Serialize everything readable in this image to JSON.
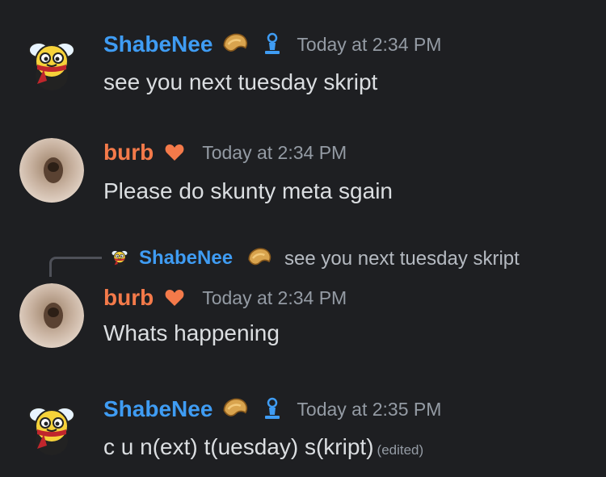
{
  "messages": [
    {
      "username": "ShabeNee",
      "timestamp": "Today at 2:34 PM",
      "text": "see you next tuesday skript",
      "name_color": "#3f9cf3",
      "badges": [
        "fortune-cookie-icon",
        "chess-pawn-icon"
      ]
    },
    {
      "username": "burb",
      "timestamp": "Today at 2:34 PM",
      "text": "Please do skunty meta sgain",
      "name_color": "#f47a4a",
      "badges": [
        "heart-icon"
      ]
    },
    {
      "reply_to": {
        "username": "ShabeNee",
        "text": "see you next tuesday skript"
      },
      "username": "burb",
      "timestamp": "Today at 2:34 PM",
      "text": "Whats happening",
      "name_color": "#f47a4a",
      "badges": [
        "heart-icon"
      ]
    },
    {
      "username": "ShabeNee",
      "timestamp": "Today at 2:35 PM",
      "text": "c u n(ext) t(uesday) s(kript)",
      "edited": "(edited)",
      "name_color": "#3f9cf3",
      "badges": [
        "fortune-cookie-icon",
        "chess-pawn-icon"
      ]
    }
  ]
}
